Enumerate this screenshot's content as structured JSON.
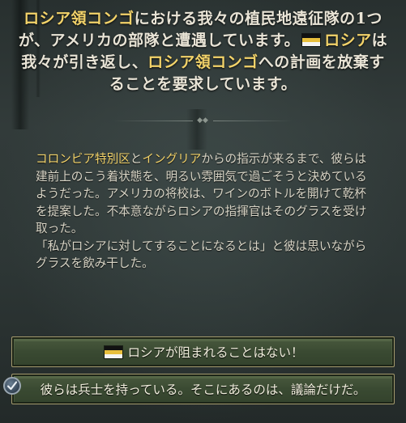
{
  "event": {
    "description": {
      "l1_a": "ロシア領コンゴ",
      "l1_b": "における我々の植民地遠征隊の1つ",
      "l2_a": "が、アメリカの部隊と遭遇しています。",
      "l2_b": "ロシア",
      "l3_a": "は我々が引き返し、",
      "l3_b": "ロシア領コンゴ",
      "l3_c": "への計画を放棄",
      "l4_a": "することを要求しています。"
    },
    "flavor": {
      "p1_a": "コロンビア特別区",
      "p1_b": "と",
      "p1_c": "イングリア",
      "p1_d": "からの指示が来るまで、彼らは建前上のこう着状態を、明るい雰囲気で過ごそうと決めているようだった。アメリカの将校は、ワインのボトルを開けて乾杯を提案した。不本意ながらロシアの指揮官はそのグラスを受け取った。",
      "p2": "「私がロシアに対してすることになるとは」と彼は思いながらグラスを飲み干した。"
    }
  },
  "options": [
    {
      "label": "ロシアが阻まれることはない！",
      "icon": "russia-flag-icon"
    },
    {
      "label": "彼らは兵士を持っている。そこにあるのは、議論だけだ。",
      "icon": "check-icon"
    }
  ],
  "colors": {
    "highlight": "#f3d36a",
    "button": "#3a4a32",
    "button_border": "#a49a6e"
  }
}
